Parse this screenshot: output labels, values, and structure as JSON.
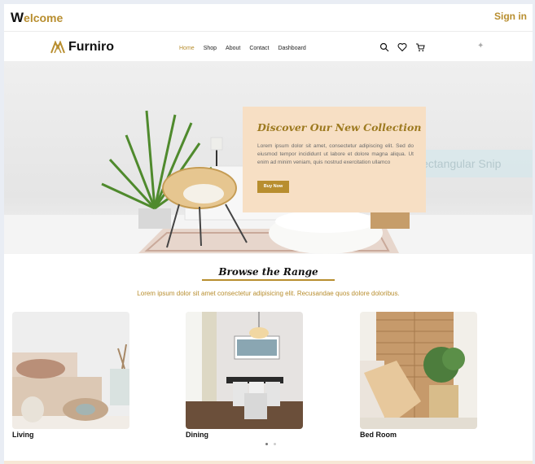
{
  "header": {
    "welcome_initial": "W",
    "welcome_rest": "elcome",
    "signin_label": "Sign in"
  },
  "nav": {
    "brand": "Furniro",
    "menu": [
      {
        "label": "Home",
        "active": true
      },
      {
        "label": "Shop",
        "active": false
      },
      {
        "label": "About",
        "active": false
      },
      {
        "label": "Contact",
        "active": false
      },
      {
        "label": "Dashboard",
        "active": false
      }
    ],
    "icons": [
      "search-icon",
      "heart-icon",
      "cart-icon"
    ]
  },
  "hero": {
    "title": "Discover Our New Collection",
    "text": "Lorem ipsum dolor sit amet, consectetur adipiscing elit. Sed do eiusmod tempor incididunt ut labore et dolore magna aliqua. Ut enim ad minim veniam, quis nostrud exercitation ullamco",
    "button_label": "Buy Now",
    "overlay_text": "Rectangular Snip"
  },
  "range": {
    "title": "Browse the Range",
    "subtitle": "Lorem ipsum dolor sit amet consectetur adipisicing elit. Recusandae quos dolore doloribus.",
    "categories": [
      {
        "label": "Living"
      },
      {
        "label": "Dining"
      },
      {
        "label": "Bed Room"
      }
    ]
  },
  "carousel": {
    "active_dot": 0,
    "dots": 2
  },
  "colors": {
    "accent": "#b88e2f",
    "hero_box": "#f7dfc4"
  }
}
